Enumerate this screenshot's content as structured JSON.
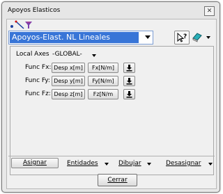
{
  "window": {
    "title": "Apoyos Elasticos",
    "close_label": "✕"
  },
  "toolbar": {
    "icons": [
      "point-icon",
      "line-icon",
      "filter-icon"
    ]
  },
  "combo": {
    "selected": "Apoyos-Elast. NL Lineales"
  },
  "panel": {
    "local_axes_label": "Local Axes",
    "local_axes_value": "-GLOBAL-",
    "rows": [
      {
        "label": "Func Fx:",
        "desp": "Desp x[m]",
        "force": "Fx[N/m]"
      },
      {
        "label": "Func Fy:",
        "desp": "Desp y[m]",
        "force": "Fy[N/m]"
      },
      {
        "label": "Func Fz:",
        "desp": "Desp z[m]",
        "force": "Fz[N/m"
      }
    ]
  },
  "bottom": {
    "asignar": "Asignar",
    "entidades": "Entidades",
    "dibujar": "Dibujar",
    "desasignar": "Desasignar"
  },
  "close_button": "Cerrar"
}
